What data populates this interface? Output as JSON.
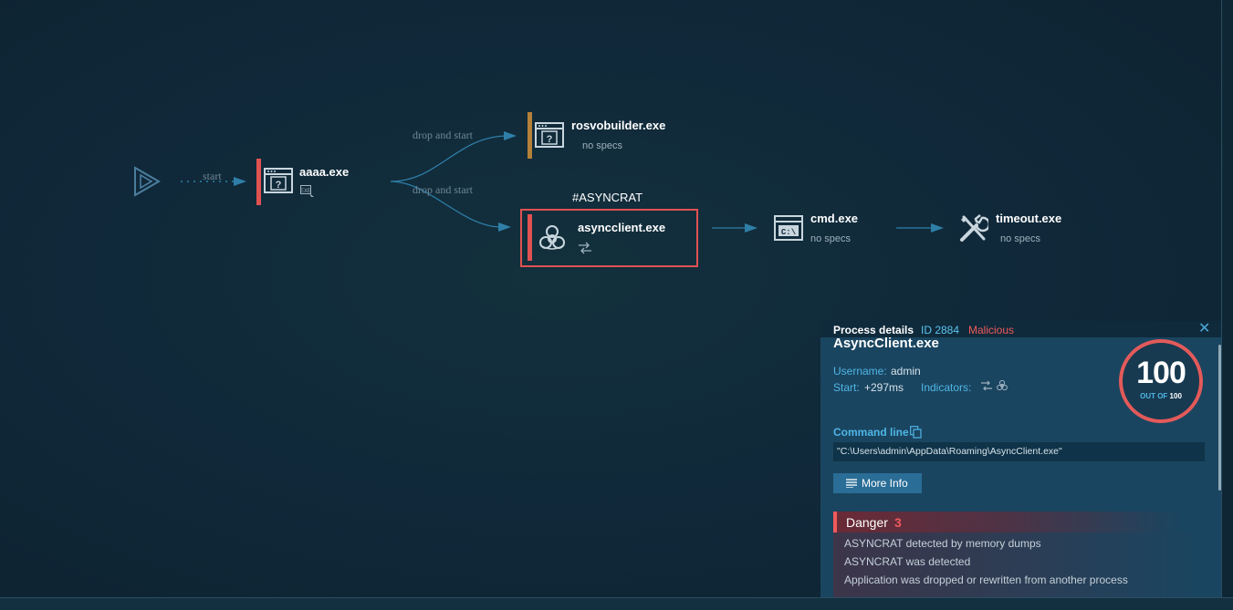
{
  "graph": {
    "start_label": "start",
    "edge_drop1": "drop and start",
    "edge_drop2": "drop and start",
    "nodes": {
      "aaaa": {
        "name": "aaaa.exe"
      },
      "rosvo": {
        "name": "rosvobuilder.exe",
        "sub": "no specs"
      },
      "async": {
        "name": "asyncclient.exe",
        "tag": "#ASYNCRAT"
      },
      "cmd": {
        "name": "cmd.exe",
        "sub": "no specs"
      },
      "timeout": {
        "name": "timeout.exe",
        "sub": "no specs"
      }
    },
    "colors": {
      "malicious": "#e05252",
      "suspicious": "#b5803a",
      "edge": "#2f7fa8"
    }
  },
  "panel": {
    "header_title": "Process details",
    "id_label": "ID 2884",
    "verdict": "Malicious",
    "close_icon": "close-icon",
    "process_name": "AsyncClient.exe",
    "username_label": "Username:",
    "username_value": "admin",
    "start_label": "Start:",
    "start_value": "+297ms",
    "indicators_label": "Indicators:",
    "score": "100",
    "score_out_of": "OUT OF",
    "score_max": "100",
    "command_line_label": "Command line",
    "command_line": "\"C:\\Users\\admin\\AppData\\Roaming\\AsyncClient.exe\"",
    "more_info": "More Info",
    "danger_title": "Danger",
    "danger_count": "3",
    "danger_items": [
      "ASYNCRAT detected by memory dumps",
      "ASYNCRAT was detected",
      "Application was dropped or rewritten from another process"
    ]
  }
}
